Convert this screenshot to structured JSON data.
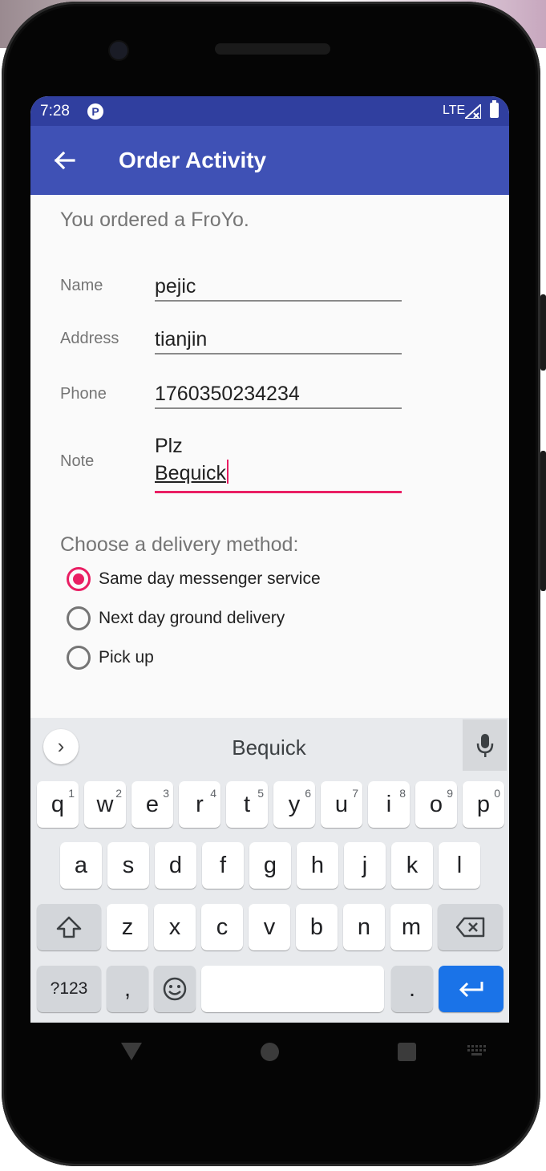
{
  "status_bar": {
    "time": "7:28",
    "app_icon": "P",
    "network": "LTE",
    "signal_icon": "signal-icon",
    "battery_icon": "battery-icon"
  },
  "app_bar": {
    "title": "Order Activity",
    "back_icon": "arrow-back-icon",
    "background_color": "#3f51b5",
    "status_color": "#303f9f"
  },
  "order_message": "You ordered a FroYo.",
  "form": {
    "name_label": "Name",
    "name_value": "pejic",
    "address_label": "Address",
    "address_value": "tianjin",
    "phone_label": "Phone",
    "phone_value": "1760350234234",
    "note_label": "Note",
    "note_line1": "Plz",
    "note_line2": "Bequick"
  },
  "delivery": {
    "heading": "Choose a delivery method:",
    "options": [
      {
        "label": "Same day messenger service",
        "checked": true
      },
      {
        "label": "Next day ground delivery",
        "checked": false
      },
      {
        "label": "Pick up",
        "checked": false
      }
    ],
    "accent_color": "#e91e63"
  },
  "keyboard": {
    "suggestion": "Bequick",
    "row1": [
      {
        "k": "q",
        "h": "1"
      },
      {
        "k": "w",
        "h": "2"
      },
      {
        "k": "e",
        "h": "3"
      },
      {
        "k": "r",
        "h": "4"
      },
      {
        "k": "t",
        "h": "5"
      },
      {
        "k": "y",
        "h": "6"
      },
      {
        "k": "u",
        "h": "7"
      },
      {
        "k": "i",
        "h": "8"
      },
      {
        "k": "o",
        "h": "9"
      },
      {
        "k": "p",
        "h": "0"
      }
    ],
    "row2": [
      "a",
      "s",
      "d",
      "f",
      "g",
      "h",
      "j",
      "k",
      "l"
    ],
    "row3": [
      "z",
      "x",
      "c",
      "v",
      "b",
      "n",
      "m"
    ],
    "symbols_label": "?123",
    "comma": ",",
    "period": ".",
    "enter_color": "#1a73e8"
  },
  "nav_bar": {
    "back_icon": "nav-back-icon",
    "home_icon": "nav-home-icon",
    "recents_icon": "nav-recents-icon",
    "keyboard_icon": "keyboard-switch-icon"
  }
}
